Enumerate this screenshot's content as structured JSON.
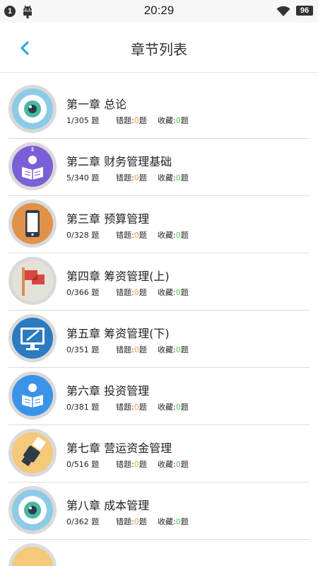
{
  "status_bar": {
    "notification_count": "1",
    "time": "20:29",
    "battery": "96"
  },
  "header": {
    "title": "章节列表"
  },
  "chapters": [
    {
      "title": "第一章  总论",
      "progress": "1/305 题",
      "wrong_label": "错题:",
      "wrong_count": "0",
      "wrong_unit": "题",
      "fav_label": "收藏:",
      "fav_count": "0",
      "fav_unit": "题",
      "icon": "eye-icon"
    },
    {
      "title": "第二章  财务管理基础",
      "progress": "5/340 题",
      "wrong_label": "错题:",
      "wrong_count": "0",
      "wrong_unit": "题",
      "fav_label": "收藏:",
      "fav_count": "0",
      "fav_unit": "题",
      "icon": "reader-icon"
    },
    {
      "title": "第三章  预算管理",
      "progress": "0/328 题",
      "wrong_label": "错题:",
      "wrong_count": "0",
      "wrong_unit": "题",
      "fav_label": "收藏:",
      "fav_count": "0",
      "fav_unit": "题",
      "icon": "phone-icon"
    },
    {
      "title": "第四章  筹资管理(上)",
      "progress": "0/366 题",
      "wrong_label": "错题:",
      "wrong_count": "0",
      "wrong_unit": "题",
      "fav_label": "收藏:",
      "fav_count": "0",
      "fav_unit": "题",
      "icon": "flag-icon"
    },
    {
      "title": "第五章  筹资管理(下)",
      "progress": "0/351 题",
      "wrong_label": "错题:",
      "wrong_count": "0",
      "wrong_unit": "题",
      "fav_label": "收藏:",
      "fav_count": "0",
      "fav_unit": "题",
      "icon": "monitor-pen-icon"
    },
    {
      "title": "第六章  投资管理",
      "progress": "0/381 题",
      "wrong_label": "错题:",
      "wrong_count": "0",
      "wrong_unit": "题",
      "fav_label": "收藏:",
      "fav_count": "0",
      "fav_unit": "题",
      "icon": "reader-icon"
    },
    {
      "title": "第七章  营运资金管理",
      "progress": "0/516 题",
      "wrong_label": "错题:",
      "wrong_count": "0",
      "wrong_unit": "题",
      "fav_label": "收藏:",
      "fav_count": "0",
      "fav_unit": "题",
      "icon": "gear-icon"
    },
    {
      "title": "第八章  成本管理",
      "progress": "0/362 题",
      "wrong_label": "错题:",
      "wrong_count": "0",
      "wrong_unit": "题",
      "fav_label": "收藏:",
      "fav_count": "0",
      "fav_unit": "题",
      "icon": "eye-icon"
    }
  ],
  "colors": {
    "accent": "#2a9ee0",
    "wrong_count": "#e8a93c",
    "fav_count": "#5bc25b"
  }
}
